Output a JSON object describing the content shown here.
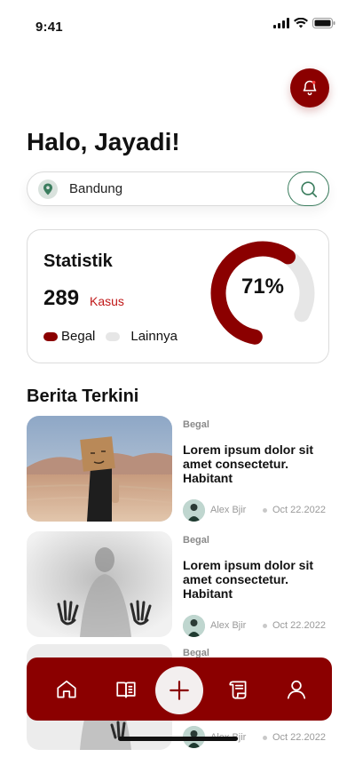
{
  "status_bar": {
    "time": "9:41"
  },
  "header": {
    "greeting": "Halo, Jayadi!",
    "bell_icon": "bell-icon"
  },
  "search": {
    "value": "Bandung",
    "location_icon": "map-pin-icon",
    "search_icon": "search-icon"
  },
  "stats": {
    "title": "Statistik",
    "count": "289",
    "unit": "Kasus",
    "percent_label": "71%",
    "percent_value": 0.71,
    "legend": [
      {
        "label": "Begal",
        "color": "#8b0000"
      },
      {
        "label": "Lainnya",
        "color": "#e6e6e6"
      }
    ]
  },
  "news": {
    "section_title": "Berita Terkini",
    "items": [
      {
        "category": "Begal",
        "headline": "Lorem ipsum dolor sit amet consectetur. Habitant",
        "author": "Alex Bjir",
        "date": "Oct 22.2022",
        "image": "person-with-box-mask-desert"
      },
      {
        "category": "Begal",
        "headline": "Lorem ipsum dolor sit amet consectetur. Habitant",
        "author": "Alex Bjir",
        "date": "Oct 22.2022",
        "image": "blurred-silhouette-behind-glass"
      },
      {
        "category": "Begal",
        "headline": "",
        "author": "Alex Bjir",
        "date": "Oct 22.2022",
        "image": "blurred-silhouette-behind-glass"
      }
    ]
  },
  "bottom_nav": {
    "items": [
      "home-icon",
      "book-icon",
      "plus-icon",
      "scroll-icon",
      "user-icon"
    ],
    "accent": "#8b0000"
  }
}
